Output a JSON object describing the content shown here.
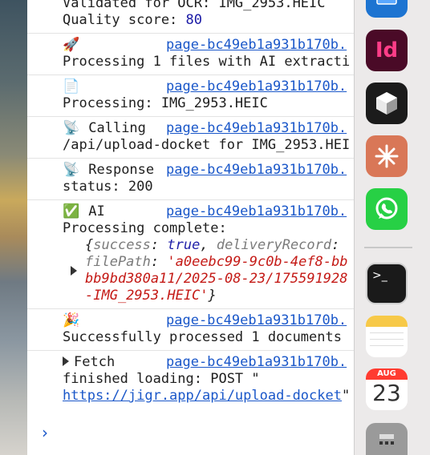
{
  "console": {
    "entries": [
      {
        "emoji": "",
        "text": "Validated for OCR: IMG_2953.HEIC",
        "cont": "Quality score: ",
        "num": "80"
      },
      {
        "emoji": "🚀",
        "source": "page-bc49eb1a931b170b.",
        "text": "Processing 1 files with AI extracti"
      },
      {
        "emoji": "📄",
        "source": "page-bc49eb1a931b170b.",
        "text": "Processing: IMG_2953.HEIC"
      },
      {
        "emoji": "📡",
        "head": "Calling",
        "source": "page-bc49eb1a931b170b.",
        "text": "/api/upload-docket for IMG_2953.HEI"
      },
      {
        "emoji": "📡",
        "head": "Response",
        "source": "page-bc49eb1a931b170b.",
        "text": "status: 200"
      },
      {
        "emoji": "✅",
        "head": "AI",
        "source": "page-bc49eb1a931b170b.",
        "text": "Processing complete:",
        "obj_line1_open": "{",
        "obj_key1": "success",
        "obj_colon": ": ",
        "obj_val1": "true",
        "obj_comma": ", ",
        "obj_key2": "deliveryRecord",
        "obj_colon2": ":",
        "obj_key3": "filePath",
        "obj_str1": "'a0eebc99-9c0b-4ef8-bb",
        "obj_str2": "bb9bd380a11/2025-08-23/175591928",
        "obj_str3": "-IMG_2953.HEIC'",
        "obj_close": "}"
      },
      {
        "emoji": "🎉",
        "source": "page-bc49eb1a931b170b.",
        "text": "Successfully processed 1 documents"
      },
      {
        "head": "Fetch",
        "source": "page-bc49eb1a931b170b.",
        "text": "finished loading: POST \"",
        "url": "https://jigr.app/api/upload-docket",
        "tail": "\""
      }
    ],
    "prompt": "›"
  },
  "dock": {
    "indesign_label": "Id",
    "calendar_month": "AUG",
    "calendar_day": "23",
    "terminal_prompt": ">_"
  }
}
